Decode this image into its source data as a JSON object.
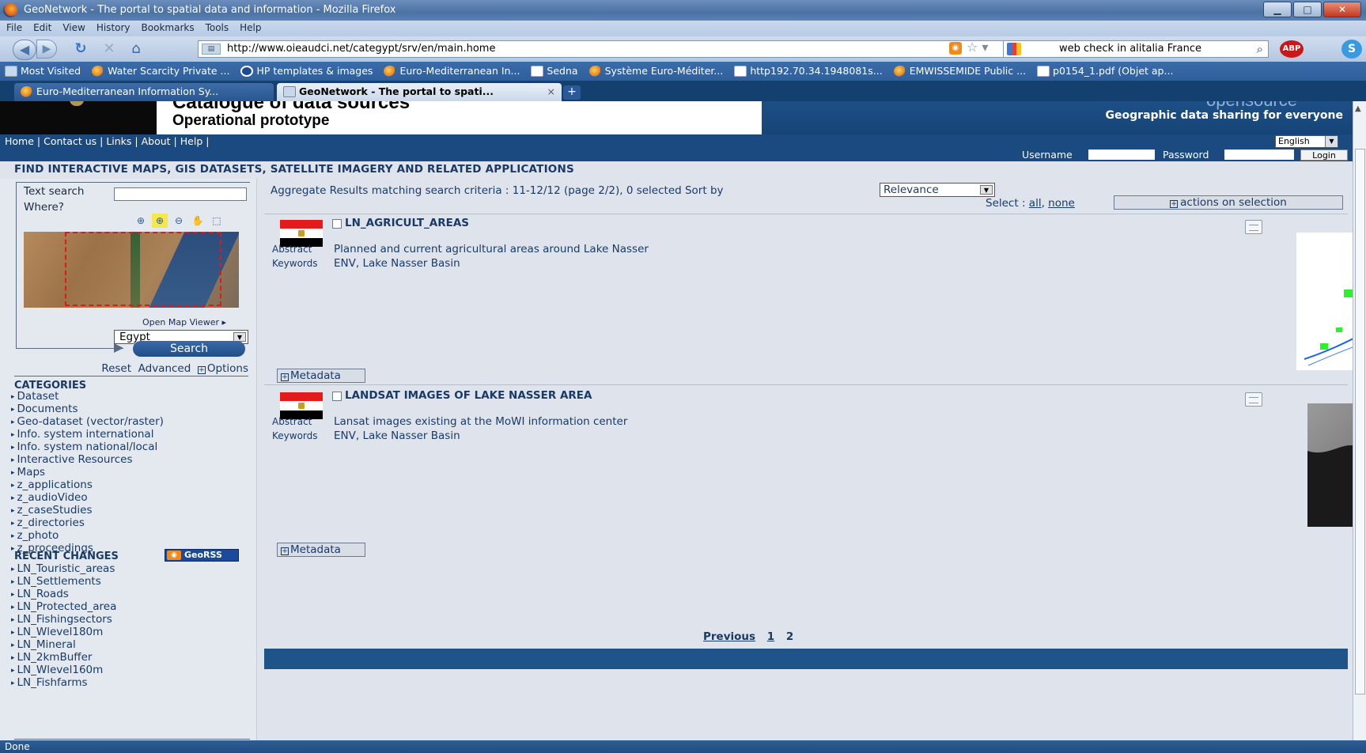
{
  "window": {
    "title": "GeoNetwork - The portal to spatial data and information - Mozilla Firefox"
  },
  "menu": [
    "File",
    "Edit",
    "View",
    "History",
    "Bookmarks",
    "Tools",
    "Help"
  ],
  "nav": {
    "url": "http://www.oieaudci.net/categypt/srv/en/main.home",
    "search_text": "web check in alitalia France",
    "abp": "ABP",
    "skype": "S"
  },
  "bookmarks": [
    {
      "label": "Most Visited",
      "icon": "bar"
    },
    {
      "label": "Water Scarcity Private ...",
      "icon": "bird"
    },
    {
      "label": "HP templates & images",
      "icon": "hp"
    },
    {
      "label": "Euro-Mediterranean In...",
      "icon": "bird"
    },
    {
      "label": "Sedna",
      "icon": "page"
    },
    {
      "label": "Système Euro-Méditer...",
      "icon": "bird"
    },
    {
      "label": "http192.70.34.1948081s...",
      "icon": "page"
    },
    {
      "label": "EMWISSEMIDE Public ...",
      "icon": "bird"
    },
    {
      "label": "p0154_1.pdf (Objet ap...",
      "icon": "page"
    }
  ],
  "tabs": {
    "tab1": "Euro-Mediterranean Information Sy...",
    "tab2": "GeoNetwork - The portal to spati...",
    "close": "×",
    "new": "+"
  },
  "banner": {
    "title": "Catalogue of data sources",
    "subtitle": "Operational prototype",
    "brand": "opensource",
    "tagline": "Geographic data sharing for everyone"
  },
  "topnav": {
    "home": "Home",
    "contact": "Contact us",
    "links": "Links",
    "about": "About",
    "help": "Help",
    "sep": " | ",
    "language": "English"
  },
  "login": {
    "username_label": "Username",
    "password_label": "Password",
    "login_button": "Login"
  },
  "find_heading": "FIND INTERACTIVE MAPS, GIS DATASETS, SATELLITE IMAGERY AND RELATED APPLICATIONS",
  "left": {
    "text_search": "Text search",
    "where": "Where?",
    "open_map_viewer": "Open Map Viewer ▸",
    "country": "Egypt",
    "search_button": "Search",
    "reset": "Reset",
    "advanced": "Advanced",
    "options": "Options",
    "categories_heading": "CATEGORIES",
    "categories": [
      "Dataset",
      "Documents",
      "Geo-dataset (vector/raster)",
      "Info. system international",
      "Info. system national/local",
      "Interactive Resources",
      "Maps",
      "z_applications",
      "z_audioVideo",
      "z_caseStudies",
      "z_directories",
      "z_photo",
      "z_proceedings"
    ],
    "recent_heading": "RECENT CHANGES",
    "georss": "GeoRSS",
    "recent": [
      "LN_Touristic_areas",
      "LN_Settlements",
      "LN_Roads",
      "LN_Protected_area",
      "LN_Fishingsectors",
      "LN_Wlevel180m",
      "LN_Mineral",
      "LN_2kmBuffer",
      "LN_Wlevel160m",
      "LN_Fishfarms"
    ]
  },
  "results": {
    "summary": "Aggregate Results matching search criteria :  11-12/12  (page 2/2),  0 selected  Sort by",
    "sort_value": "Relevance",
    "select_label": "Select :",
    "select_all": "all",
    "select_none": "none",
    "actions": "actions on selection",
    "abstract_label": "Abstract",
    "keywords_label": "Keywords",
    "metadata_button": "Metadata",
    "records": [
      {
        "title": "LN_AGRICULT_AREAS",
        "abstract": "Planned and current agricultural areas around Lake Nasser",
        "keywords": "ENV, Lake Nasser Basin"
      },
      {
        "title": "LANDSAT IMAGES OF LAKE NASSER AREA",
        "abstract": "Lansat images existing at the MoWI information center",
        "keywords": "ENV, Lake Nasser Basin"
      }
    ],
    "pager": {
      "previous": "Previous",
      "p1": "1",
      "p2": "2"
    }
  },
  "status": "Done"
}
